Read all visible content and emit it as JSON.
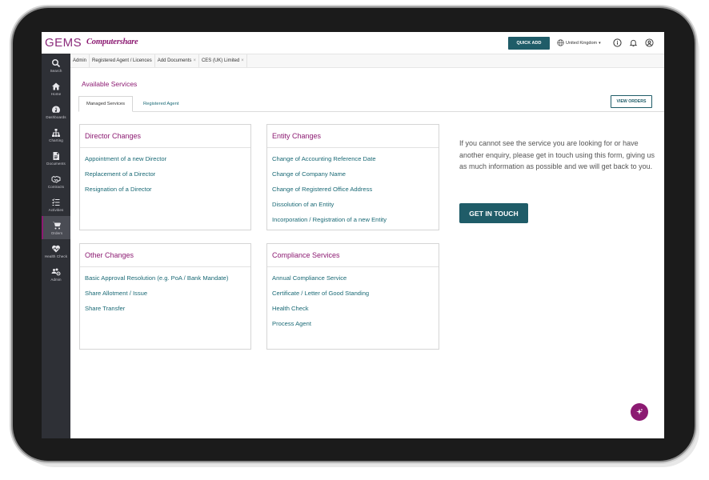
{
  "brand": {
    "gems": "GEMS",
    "company": "Computershare"
  },
  "header": {
    "quick_add": "QUICK ADD",
    "region": "United Kingdom"
  },
  "sidebar": {
    "items": [
      {
        "label": "Search",
        "icon": "search-icon"
      },
      {
        "label": "Home",
        "icon": "home-icon"
      },
      {
        "label": "Dashboards",
        "icon": "dashboard-icon"
      },
      {
        "label": "Charting",
        "icon": "org-chart-icon"
      },
      {
        "label": "Documents",
        "icon": "document-icon"
      },
      {
        "label": "Contracts",
        "icon": "handshake-icon"
      },
      {
        "label": "Activities",
        "icon": "checklist-icon"
      },
      {
        "label": "Orders",
        "icon": "cart-icon"
      },
      {
        "label": "Health Check",
        "icon": "heart-icon"
      },
      {
        "label": "Admin",
        "icon": "users-gear-icon"
      }
    ]
  },
  "tabs": [
    {
      "label": "Admin",
      "closable": false
    },
    {
      "label": "Registered Agent / Licences",
      "closable": false
    },
    {
      "label": "Add Documents",
      "closable": true
    },
    {
      "label": "CES (UK) Limited",
      "closable": true
    }
  ],
  "page": {
    "title": "Available Services",
    "subtabs": [
      "Managed Services",
      "Registered Agent"
    ],
    "view_orders": "VIEW ORDERS"
  },
  "cards": {
    "director": {
      "title": "Director Changes",
      "links": [
        "Appointment of a new Director",
        "Replacement of a Director",
        "Resignation of a Director"
      ]
    },
    "entity": {
      "title": "Entity Changes",
      "links": [
        "Change of Accounting Reference Date",
        "Change of Company Name",
        "Change of Registered Office Address",
        "Dissolution of an Entity",
        "Incorporation / Registration of a new Entity"
      ]
    },
    "other": {
      "title": "Other Changes",
      "links": [
        "Basic Approval Resolution (e.g. PoA / Bank Mandate)",
        "Share Allotment / Issue",
        "Share Transfer"
      ]
    },
    "compliance": {
      "title": "Compliance Services",
      "links": [
        "Annual Compliance Service",
        "Certificate / Letter of Good Standing",
        "Health Check",
        "Process Agent"
      ]
    }
  },
  "contact": {
    "text": "If you cannot see the service you are looking for or have another enquiry, please get in touch using this form, giving us as much information as possible and we will get back to you.",
    "button": "GET IN TOUCH"
  },
  "colors": {
    "brand": "#8c1a72",
    "teal": "#1f5c68",
    "link": "#1b6a76",
    "sidebar": "#2e3036"
  }
}
